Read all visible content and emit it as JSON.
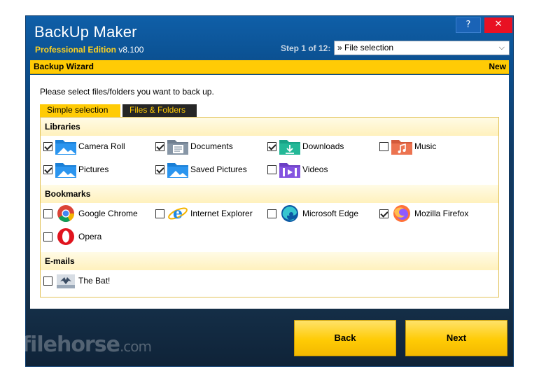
{
  "window": {
    "title": "BackUp Maker",
    "edition": "Professional Edition",
    "version": "v8.100",
    "help_button": "?",
    "close_button": "✕"
  },
  "step": {
    "label": "Step 1 of 12:",
    "selected": "» File selection"
  },
  "wizard": {
    "title": "Backup Wizard",
    "badge": "New"
  },
  "instruction": "Please select files/folders you want to back up.",
  "tabs": [
    {
      "label": "Simple selection",
      "active": true
    },
    {
      "label": "Files & Folders",
      "active": false
    }
  ],
  "groups": {
    "libraries": {
      "title": "Libraries",
      "items": [
        {
          "label": "Camera Roll",
          "checked": true,
          "icon": "camera-roll-folder-icon"
        },
        {
          "label": "Documents",
          "checked": true,
          "icon": "documents-folder-icon"
        },
        {
          "label": "Downloads",
          "checked": true,
          "icon": "downloads-folder-icon"
        },
        {
          "label": "Music",
          "checked": false,
          "icon": "music-folder-icon"
        },
        {
          "label": "Pictures",
          "checked": true,
          "icon": "pictures-folder-icon"
        },
        {
          "label": "Saved Pictures",
          "checked": true,
          "icon": "saved-pictures-folder-icon"
        },
        {
          "label": "Videos",
          "checked": false,
          "icon": "videos-folder-icon"
        }
      ]
    },
    "bookmarks": {
      "title": "Bookmarks",
      "items": [
        {
          "label": "Google Chrome",
          "checked": false,
          "icon": "chrome-icon"
        },
        {
          "label": "Internet Explorer",
          "checked": false,
          "icon": "internet-explorer-icon"
        },
        {
          "label": "Microsoft Edge",
          "checked": false,
          "icon": "edge-icon"
        },
        {
          "label": "Mozilla Firefox",
          "checked": true,
          "icon": "firefox-icon"
        },
        {
          "label": "Opera",
          "checked": false,
          "icon": "opera-icon"
        }
      ]
    },
    "emails": {
      "title": "E-mails",
      "items": [
        {
          "label": "The Bat!",
          "checked": false,
          "icon": "the-bat-icon"
        }
      ]
    }
  },
  "buttons": {
    "back": "Back",
    "next": "Next"
  },
  "watermark": {
    "main": "filehorse",
    "suffix": ".com"
  },
  "colors": {
    "accent_yellow": "#ffcb05",
    "window_blue": "#0b4f8f",
    "close_red": "#e81123"
  }
}
